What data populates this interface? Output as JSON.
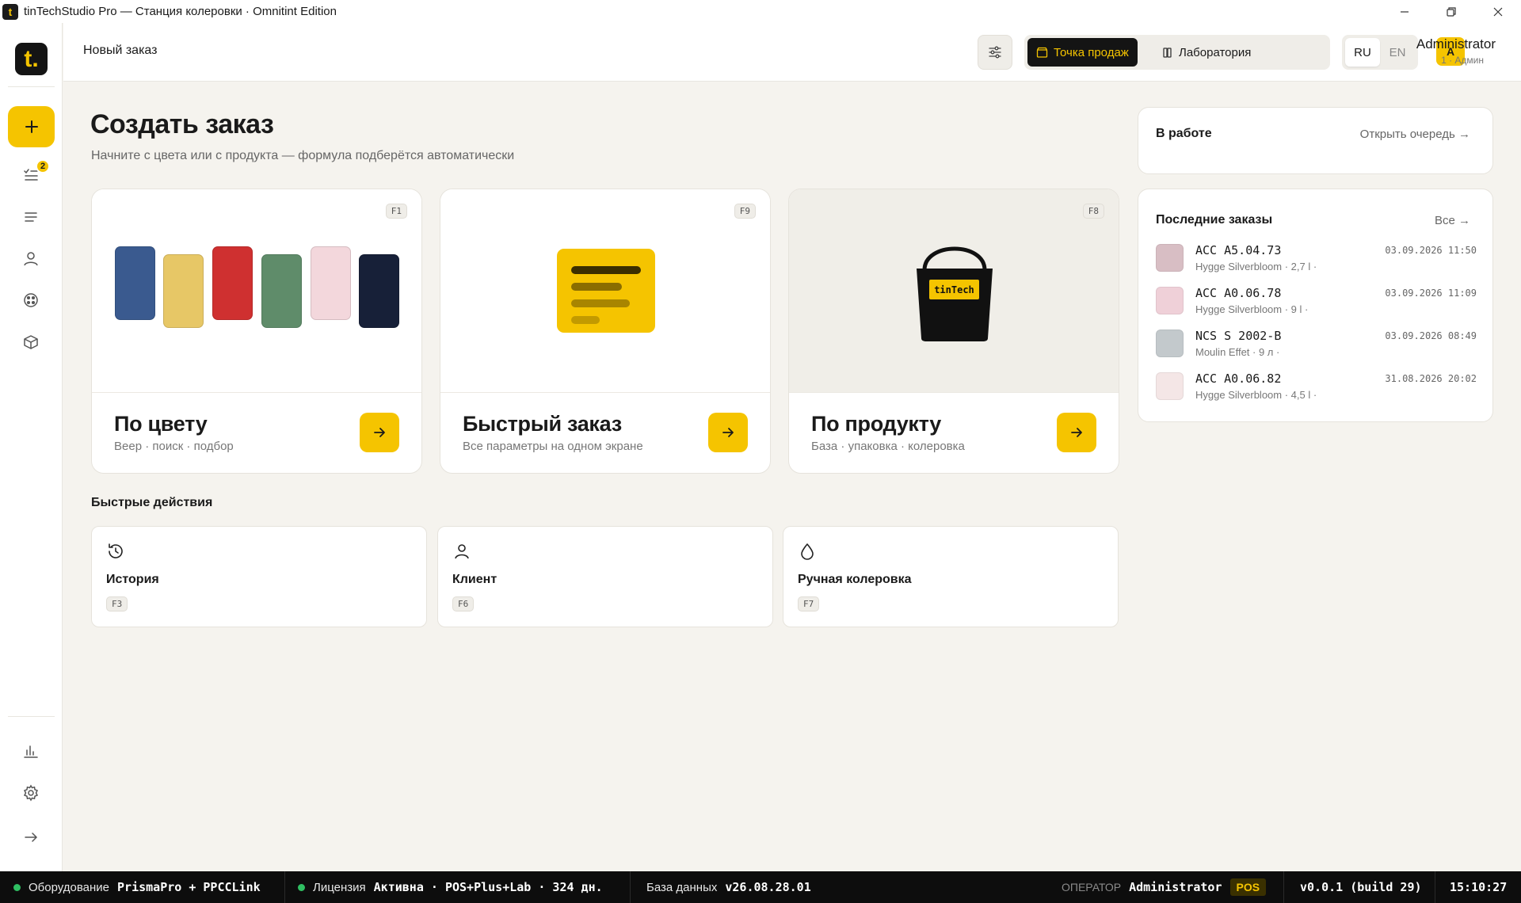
{
  "window": {
    "title": "tinTechStudio Pro — Станция колеровки · Omnitint Edition",
    "app_icon": "t"
  },
  "sidebar": {
    "logo": "t.",
    "orders_badge": "2"
  },
  "header": {
    "breadcrumb": "Новый заказ",
    "mode_pos": "Точка продаж",
    "mode_lab": "Лаборатория",
    "lang_ru": "RU",
    "lang_en": "EN",
    "user_initial": "A",
    "user_name": "Administrator",
    "user_role": "1 · Админ"
  },
  "main": {
    "title": "Создать заказ",
    "subtitle": "Начните с цвета или с продукта — формула подберётся автоматически",
    "cards": [
      {
        "title": "По цвету",
        "subtitle": "Веер · поиск · подбор",
        "key": "F1"
      },
      {
        "title": "Быстрый заказ",
        "subtitle": "Все параметры на одном экране",
        "key": "F9"
      },
      {
        "title": "По продукту",
        "subtitle": "База · упаковка · колеровка",
        "key": "F8",
        "bucket_label": "tinTech"
      }
    ],
    "swatch_colors": [
      "#3a5a8f",
      "#e7c766",
      "#cf3030",
      "#5f8c6a",
      "#f3d7dc",
      "#172038"
    ],
    "quick_actions_title": "Быстрые действия",
    "quick_actions": [
      {
        "label": "История",
        "key": "F3",
        "icon": "history-icon"
      },
      {
        "label": "Клиент",
        "key": "F6",
        "icon": "user-icon"
      },
      {
        "label": "Ручная колеровка",
        "key": "F7",
        "icon": "drop-icon"
      }
    ]
  },
  "in_work": {
    "title": "В работе",
    "link": "Открыть очередь →"
  },
  "recent_orders": {
    "title": "Последние заказы",
    "link": "Все →",
    "items": [
      {
        "code": "ACC A5.04.73",
        "product": "Hygge Silverbloom · 2,7 l ·",
        "date": "03.09.2026 11:50",
        "color": "#d8bec4"
      },
      {
        "code": "ACC A0.06.78",
        "product": "Hygge Silverbloom · 9 l ·",
        "date": "03.09.2026 11:09",
        "color": "#efd0d8"
      },
      {
        "code": "NCS S 2002-B",
        "product": "Moulin Effet · 9 л ·",
        "date": "03.09.2026 08:49",
        "color": "#c3c9cc"
      },
      {
        "code": "ACC A0.06.82",
        "product": "Hygge Silverbloom · 4,5 l ·",
        "date": "31.08.2026 20:02",
        "color": "#f4e6e6"
      }
    ]
  },
  "statusbar": {
    "equipment_label": "Оборудование",
    "equipment_value": "PrismaPro + PPCCLink",
    "license_label": "Лицензия",
    "license_value": "Активна · POS+Plus+Lab · 324 дн.",
    "db_label": "База данных",
    "db_value": "v26.08.28.01",
    "operator_label": "ОПЕРАТОР",
    "operator_value": "Administrator",
    "mode_chip": "POS",
    "version": "v0.0.1 (build 29)",
    "clock": "15:10:27"
  },
  "colors": {
    "accent": "#f5c400",
    "dark": "#141414",
    "background": "#f5f3ee",
    "status_ok": "#2fbf62"
  }
}
